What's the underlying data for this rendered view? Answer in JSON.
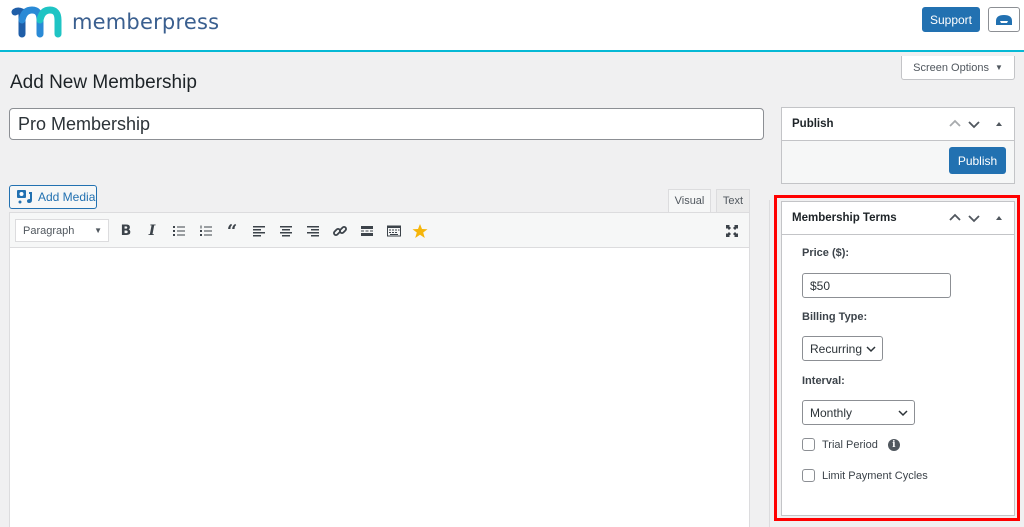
{
  "header": {
    "brand_name": "memberpress",
    "support_label": "Support",
    "inbox_icon": "inbox-icon",
    "brand_colors": {
      "dark_blue": "#1f5ea8",
      "blue": "#2a8ad6",
      "teal": "#1fc4c4",
      "accent_line": "#06b9d5"
    }
  },
  "screen_options": {
    "label": "Screen Options",
    "icon": "caret-down-icon"
  },
  "page": {
    "title": "Add New Membership",
    "title_field_value": "Pro Membership"
  },
  "editor": {
    "add_media_label": "Add Media",
    "tabs": [
      {
        "label": "Visual",
        "active": true
      },
      {
        "label": "Text",
        "active": false
      }
    ],
    "format_select": "Paragraph",
    "toolbar_icons": [
      "bold-icon",
      "italic-icon",
      "bulleted-list-icon",
      "numbered-list-icon",
      "blockquote-icon",
      "align-left-icon",
      "align-center-icon",
      "align-right-icon",
      "link-icon",
      "read-more-icon",
      "toolbar-toggle-icon",
      "star-icon"
    ],
    "fullscreen_icon": "fullscreen-icon",
    "content": ""
  },
  "publish_box": {
    "title": "Publish",
    "button_label": "Publish"
  },
  "membership_terms": {
    "title": "Membership Terms",
    "price_label": "Price ($):",
    "price_value": "$50",
    "billing_type_label": "Billing Type:",
    "billing_type_value": "Recurring",
    "interval_label": "Interval:",
    "interval_value": "Monthly",
    "trial_period_label": "Trial Period",
    "trial_period_checked": false,
    "limit_cycles_label": "Limit Payment Cycles",
    "limit_cycles_checked": false,
    "highlight_color": "#ff0000"
  },
  "colors": {
    "primary_button": "#2271b1",
    "background": "#f0f0f1"
  }
}
